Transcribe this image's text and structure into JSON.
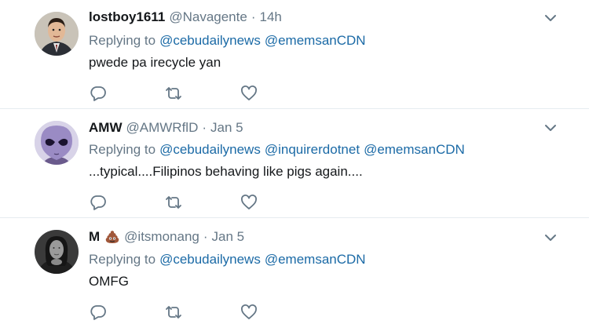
{
  "colors": {
    "link": "#1b6aa6",
    "muted": "#657786",
    "text": "#14171a",
    "divider": "#e6ecf0"
  },
  "tweets": [
    {
      "name": "lostboy1611",
      "emoji": "",
      "handle": "@Navagente",
      "dot": "·",
      "time": "14h",
      "reply_prefix": "Replying to",
      "mentions": [
        "@cebudailynews",
        "@ememsanCDN"
      ],
      "text": "pwede pa irecycle yan",
      "avatar": "man-in-suit-avatar"
    },
    {
      "name": "AMW",
      "emoji": "",
      "handle": "@AMWRflD",
      "dot": "·",
      "time": "Jan 5",
      "reply_prefix": "Replying to",
      "mentions": [
        "@cebudailynews",
        "@inquirerdotnet",
        "@ememsanCDN"
      ],
      "text": "...typical....Filipinos behaving like pigs again....",
      "avatar": "alien-avatar"
    },
    {
      "name": "M",
      "emoji": "poop-emoji",
      "handle": "@itsmonang",
      "dot": "·",
      "time": "Jan 5",
      "reply_prefix": "Replying to",
      "mentions": [
        "@cebudailynews",
        "@ememsanCDN"
      ],
      "text": "OMFG",
      "avatar": "mona-lisa-avatar"
    }
  ]
}
